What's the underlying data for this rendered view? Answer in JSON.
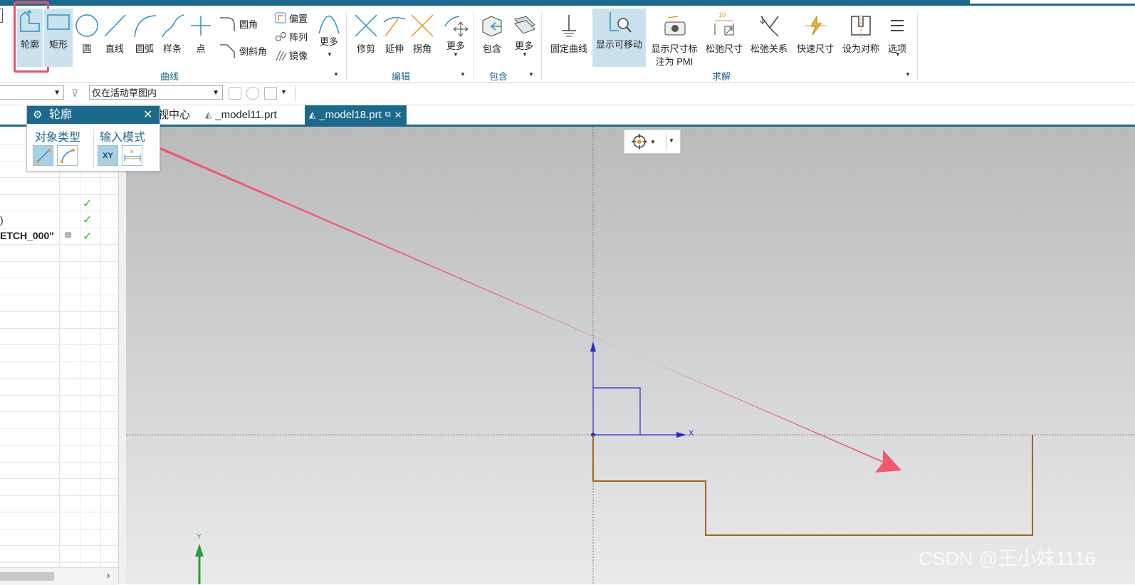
{
  "ribbon": {
    "buttons": {
      "profile": "轮廓",
      "rectangle": "矩形",
      "circle": "圆",
      "line": "直线",
      "arc": "圆弧",
      "spline": "样条",
      "point": "点",
      "fillet": "圆角",
      "chamfer": "倒斜角",
      "offset": "偏置",
      "pattern": "阵列",
      "mirror": "镜像",
      "curve_more": "更多",
      "trim": "修剪",
      "extend": "延伸",
      "corner": "拐角",
      "edit_more": "更多",
      "include": "包含",
      "include_more": "更多",
      "fix_curve": "固定曲线",
      "show_movable": "显示可移动",
      "show_dim_line1": "显示尺寸标",
      "show_dim_line2": "注为 PMI",
      "relax_dim": "松弛尺寸",
      "relax_rel": "松弛关系",
      "rapid_dim": "快速尺寸",
      "set_symmetric": "设为对称",
      "options": "选项"
    },
    "groups": {
      "curve": "曲线",
      "edit": "编辑",
      "include": "包含",
      "solve": "求解"
    },
    "relax_dim_value": "10"
  },
  "toolbar2": {
    "scope_select": "仅在活动草图内"
  },
  "tabs": {
    "partial_tab": "视中心",
    "tab1": "_model11.prt",
    "tab2": "_model18.prt"
  },
  "popup": {
    "title": "轮廓",
    "object_type": "对象类型",
    "input_mode": "输入模式",
    "xy_label": "XY"
  },
  "nav": {
    "row_paren": ")",
    "row_sketch": "ETCH_000\""
  },
  "canvas": {
    "x_axis": "X",
    "y_axis": "Y"
  },
  "watermark": "CSDN @王小妹1116",
  "colors": {
    "accent": "#1b6a8e",
    "highlight_box": "#e8526a",
    "arrow": "#f2586f",
    "sketch_curve": "#a0661a",
    "csys": "#2727d6",
    "check": "#2dbb2d"
  }
}
